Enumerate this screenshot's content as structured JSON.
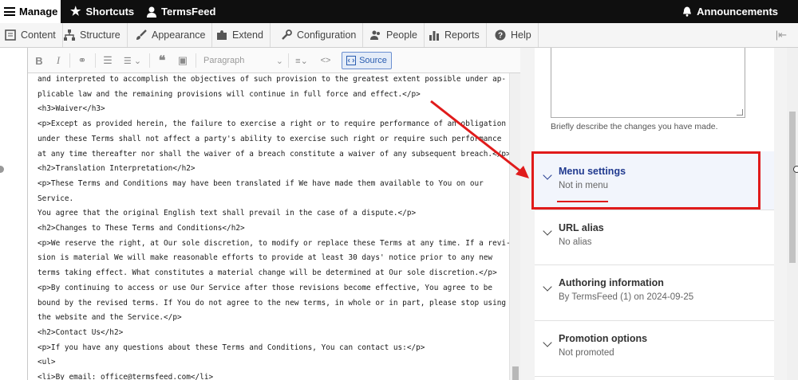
{
  "topbar": {
    "manage": "Manage",
    "shortcuts": "Shortcuts",
    "user": "TermsFeed",
    "announcements": "Announcements"
  },
  "adminmenu": {
    "items": [
      "Content",
      "Structure",
      "Appearance",
      "Extend",
      "Configuration",
      "People",
      "Reports",
      "Help"
    ]
  },
  "editor": {
    "paragraph_format": "Paragraph",
    "source_label": "Source",
    "lines": [
      "and interpreted to accomplish the objectives of such provision to the greatest extent possible under ap-",
      "plicable law and the remaining provisions will continue in full force and effect.</p>",
      "<h3>Waiver</h3>",
      "<p>Except as provided herein, the failure to exercise a right or to require performance of an obligation",
      "under these Terms shall not affect a party's ability to exercise such right or require such performance",
      "at any time thereafter nor shall the waiver of a breach constitute a waiver of any subsequent breach.</p>",
      "<h2>Translation Interpretation</h2>",
      "<p>These Terms and Conditions may have been translated if We have made them available to You on our",
      "Service.",
      "You agree that the original English text shall prevail in the case of a dispute.</p>",
      "<h2>Changes to These Terms and Conditions</h2>",
      "<p>We reserve the right, at Our sole discretion, to modify or replace these Terms at any time. If a revi-",
      "sion is material We will make reasonable efforts to provide at least 30 days' notice prior to any new",
      "terms taking effect. What constitutes a material change will be determined at Our sole discretion.</p>",
      "<p>By continuing to access or use Our Service after those revisions become effective, You agree to be",
      "bound by the revised terms. If You do not agree to the new terms, in whole or in part, please stop using",
      "the website and the Service.</p>",
      "<h2>Contact Us</h2>",
      "<p>If you have any questions about these Terms and Conditions, You can contact us:</p>",
      "<ul>",
      "<li>By email: office@termsfeed.com</li>"
    ]
  },
  "sidebar": {
    "revision_hint": "Briefly describe the changes you have made.",
    "sections": [
      {
        "title": "Menu settings",
        "summary": "Not in menu"
      },
      {
        "title": "URL alias",
        "summary": "No alias"
      },
      {
        "title": "Authoring information",
        "summary": "By TermsFeed (1) on 2024-09-25"
      },
      {
        "title": "Promotion options",
        "summary": "Not promoted"
      }
    ]
  },
  "colors": {
    "annotation_red": "#e01b1b",
    "link_blue": "#213a8f",
    "toolbar_black": "#0f0f0f"
  }
}
